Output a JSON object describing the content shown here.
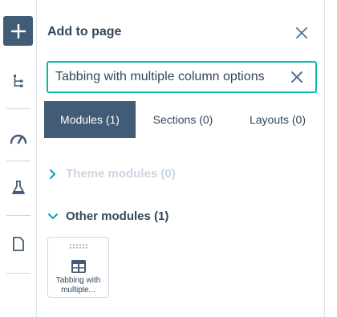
{
  "rail": {
    "items": [
      {
        "icon": "plus-icon"
      },
      {
        "icon": "tree-structure-icon"
      },
      {
        "icon": "speedometer-icon"
      },
      {
        "icon": "flask-icon"
      },
      {
        "icon": "page-icon"
      }
    ]
  },
  "panel": {
    "title": "Add to page",
    "search": {
      "value": "Tabbing with multiple column options",
      "placeholder": ""
    },
    "tabs": [
      {
        "label": "Modules (1)",
        "active": true
      },
      {
        "label": "Sections (0)",
        "active": false
      },
      {
        "label": "Layouts (0)",
        "active": false
      }
    ],
    "groups": [
      {
        "label": "Theme modules (0)",
        "expanded": false
      },
      {
        "label": "Other modules (1)",
        "expanded": true
      }
    ],
    "modules": [
      {
        "name": "Tabbing with multiple...",
        "icon": "table-layout-icon"
      }
    ]
  },
  "colors": {
    "primary": "#425b76",
    "accent": "#00bda5",
    "text": "#33475b",
    "muted": "#cbd6e2"
  }
}
